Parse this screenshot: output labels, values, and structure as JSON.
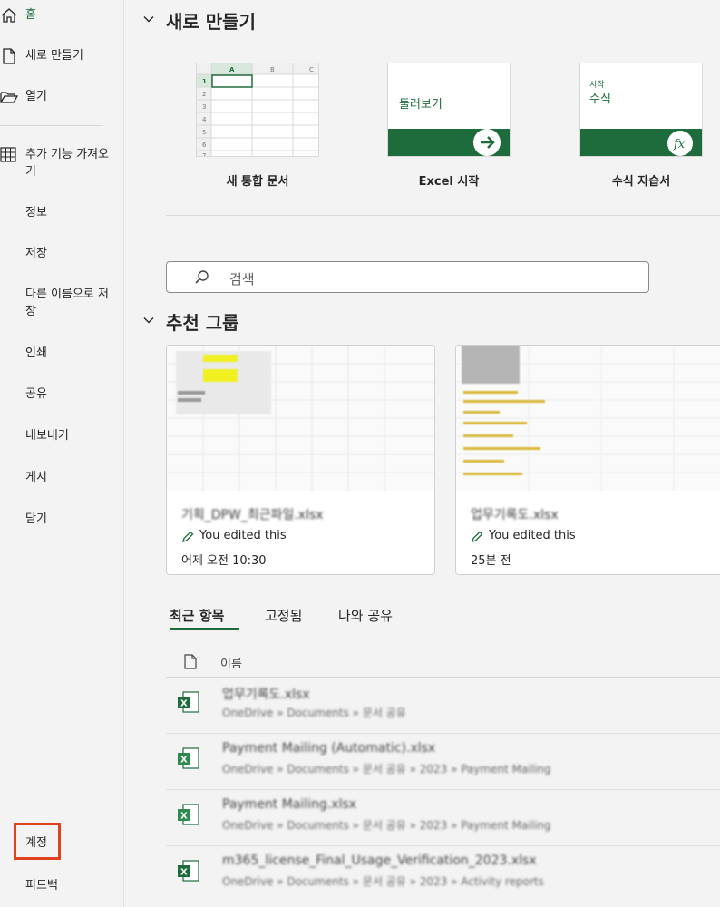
{
  "sidebar": {
    "home": "홈",
    "new": "새로 만들기",
    "open": "열기",
    "addins": "추가 기능 가져오기",
    "info": "정보",
    "save": "저장",
    "saveas": "다른 이름으로 저장",
    "print": "인쇄",
    "share": "공유",
    "export": "내보내기",
    "publish": "게시",
    "close": "닫기",
    "account": "계정",
    "feedback": "피드백"
  },
  "new_section": {
    "title": "새로 만들기",
    "templates": [
      {
        "caption": "새 통합 문서"
      },
      {
        "caption": "Excel 시작",
        "thumb_text": "둘러보기"
      },
      {
        "caption": "수식 자습서",
        "thumb_small": "시작",
        "thumb_text": "수식"
      }
    ]
  },
  "search": {
    "placeholder": "검색"
  },
  "recommended": {
    "title": "추천 그룹",
    "cards": [
      {
        "title": "기획_DPW_최근파일.xlsx",
        "edited": "You edited this",
        "time": "어제 오전 10:30"
      },
      {
        "title": "업무기록도.xlsx",
        "edited": "You edited this",
        "time": "25분 전"
      }
    ]
  },
  "tabs": {
    "recent": "최근 항목",
    "pinned": "고정됨",
    "shared": "나와 공유"
  },
  "list": {
    "header": "이름",
    "rows": [
      {
        "name": "업무기록도.xlsx",
        "path": "OneDrive » Documents » 문서 공유"
      },
      {
        "name": "Payment Mailing (Automatic).xlsx",
        "path": "OneDrive » Documents » 문서 공유 » 2023 » Payment Mailing"
      },
      {
        "name": "Payment Mailing.xlsx",
        "path": "OneDrive » Documents » 문서 공유 » 2023 » Payment Mailing"
      },
      {
        "name": "m365_license_Final_Usage_Verification_2023.xlsx",
        "path": "OneDrive » Documents » 문서 공유 » 2023 » Activity reports"
      }
    ]
  },
  "colors": {
    "accent": "#1e6b3c",
    "highlight": "#e0421f"
  }
}
